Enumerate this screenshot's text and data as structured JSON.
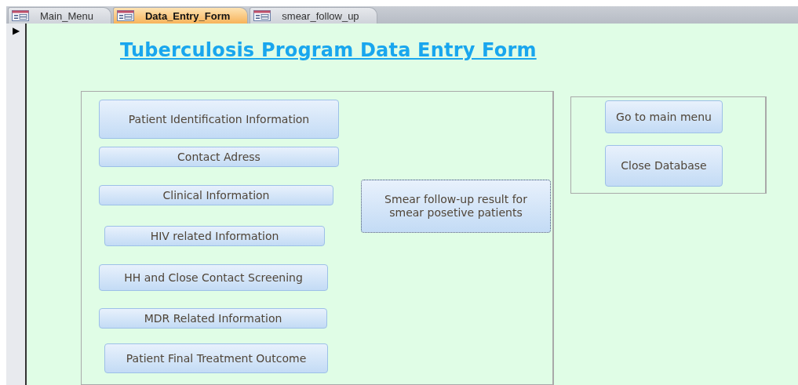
{
  "tabs": [
    {
      "label": "Main_Menu",
      "selected": false
    },
    {
      "label": "Data_Entry_Form",
      "selected": true
    },
    {
      "label": "smear_follow_up",
      "selected": false
    }
  ],
  "record_selector": {
    "marker": "▶"
  },
  "form": {
    "title": "Tuberculosis Program Data Entry Form",
    "sections_panel": {
      "buttons": [
        {
          "label": "Patient Identification Information",
          "focused": false
        },
        {
          "label": "Contact Adress",
          "focused": false
        },
        {
          "label": "Clinical Information",
          "focused": false
        },
        {
          "label": "HIV related Information",
          "focused": false
        },
        {
          "label": "HH and Close Contact Screening",
          "focused": false
        },
        {
          "label": "MDR Related Information",
          "focused": false
        },
        {
          "label": "Patient Final Treatment Outcome",
          "focused": false
        }
      ],
      "side_button": {
        "label": "Smear follow-up result for smear posetive patients",
        "focused": true
      }
    },
    "navigation_panel": {
      "buttons": [
        {
          "label": "Go to main menu",
          "focused": false
        },
        {
          "label": "Close Database",
          "focused": false
        }
      ]
    }
  }
}
